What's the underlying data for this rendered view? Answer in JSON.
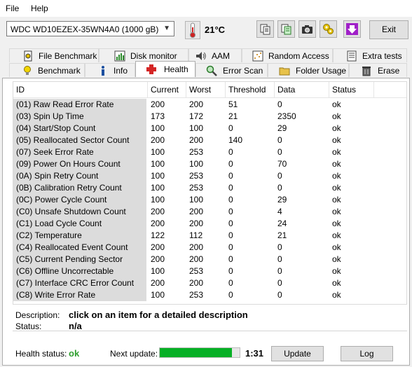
{
  "menu": {
    "file": "File",
    "help": "Help"
  },
  "toolbar": {
    "drive": "WDC WD10EZEX-35WN4A0 (1000 gB)",
    "temperature": "21°C",
    "exit_label": "Exit",
    "buttons": [
      "copy-icon",
      "copy-all-icon",
      "camera-icon",
      "settings-icon",
      "download-icon"
    ]
  },
  "tabs": {
    "row1": [
      "File Benchmark",
      "Disk monitor",
      "AAM",
      "Random Access",
      "Extra tests"
    ],
    "row2": [
      "Benchmark",
      "Info",
      "Health",
      "Error Scan",
      "Folder Usage",
      "Erase"
    ],
    "active": "Health"
  },
  "table": {
    "columns": [
      "ID",
      "Current",
      "Worst",
      "Threshold",
      "Data",
      "Status"
    ],
    "rows": [
      [
        "(01) Raw Read Error Rate",
        "200",
        "200",
        "51",
        "0",
        "ok"
      ],
      [
        "(03) Spin Up Time",
        "173",
        "172",
        "21",
        "2350",
        "ok"
      ],
      [
        "(04) Start/Stop Count",
        "100",
        "100",
        "0",
        "29",
        "ok"
      ],
      [
        "(05) Reallocated Sector Count",
        "200",
        "200",
        "140",
        "0",
        "ok"
      ],
      [
        "(07) Seek Error Rate",
        "100",
        "253",
        "0",
        "0",
        "ok"
      ],
      [
        "(09) Power On Hours Count",
        "100",
        "100",
        "0",
        "70",
        "ok"
      ],
      [
        "(0A) Spin Retry Count",
        "100",
        "253",
        "0",
        "0",
        "ok"
      ],
      [
        "(0B) Calibration Retry Count",
        "100",
        "253",
        "0",
        "0",
        "ok"
      ],
      [
        "(0C) Power Cycle Count",
        "100",
        "100",
        "0",
        "29",
        "ok"
      ],
      [
        "(C0) Unsafe Shutdown Count",
        "200",
        "200",
        "0",
        "4",
        "ok"
      ],
      [
        "(C1) Load Cycle Count",
        "200",
        "200",
        "0",
        "24",
        "ok"
      ],
      [
        "(C2) Temperature",
        "122",
        "112",
        "0",
        "21",
        "ok"
      ],
      [
        "(C4) Reallocated Event Count",
        "200",
        "200",
        "0",
        "0",
        "ok"
      ],
      [
        "(C5) Current Pending Sector",
        "200",
        "200",
        "0",
        "0",
        "ok"
      ],
      [
        "(C6) Offline Uncorrectable",
        "100",
        "253",
        "0",
        "0",
        "ok"
      ],
      [
        "(C7) Interface CRC Error Count",
        "200",
        "200",
        "0",
        "0",
        "ok"
      ],
      [
        "(C8) Write Error Rate",
        "100",
        "253",
        "0",
        "0",
        "ok"
      ]
    ]
  },
  "description": {
    "label": "Description:",
    "text": "click on an item for a detailed description",
    "status_label": "Status:",
    "status_value": "n/a"
  },
  "footer": {
    "health_label": "Health status:",
    "health_value": "ok",
    "next_update_label": "Next update:",
    "progress_fraction": 0.9,
    "countdown": "1:31",
    "update_label": "Update",
    "log_label": "Log"
  },
  "colors": {
    "progress": "#06b025",
    "health_ok": "#2e9e2e",
    "active_tab_icon": "#d42626"
  }
}
